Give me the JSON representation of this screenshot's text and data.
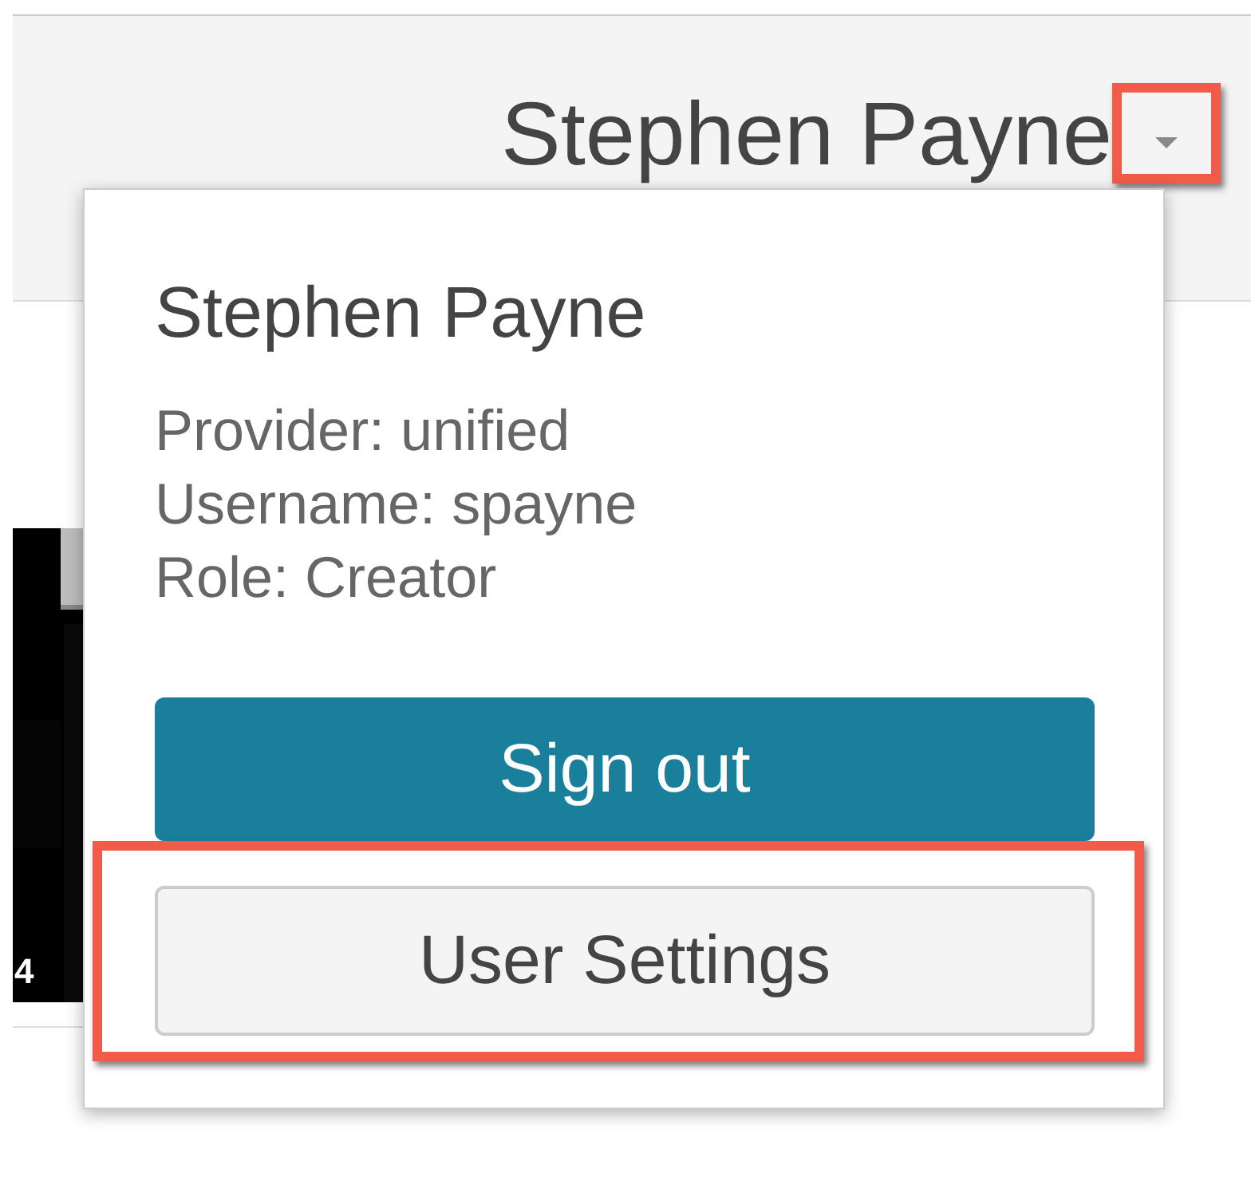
{
  "header": {
    "user_name": "Stephen Payne",
    "menu_open": true,
    "caret_highlighted": true
  },
  "thumbnail": {
    "kind": "picture",
    "label": "4"
  },
  "user_menu": {
    "name": "Stephen Payne",
    "details": [
      "Provider: unified",
      "Username: spayne",
      "Role: Creator"
    ],
    "buttons": [
      {
        "label": "Sign out",
        "kind": "primary",
        "highlighted": false
      },
      {
        "label": "User Settings",
        "kind": "secondary",
        "highlighted": true
      }
    ]
  }
}
